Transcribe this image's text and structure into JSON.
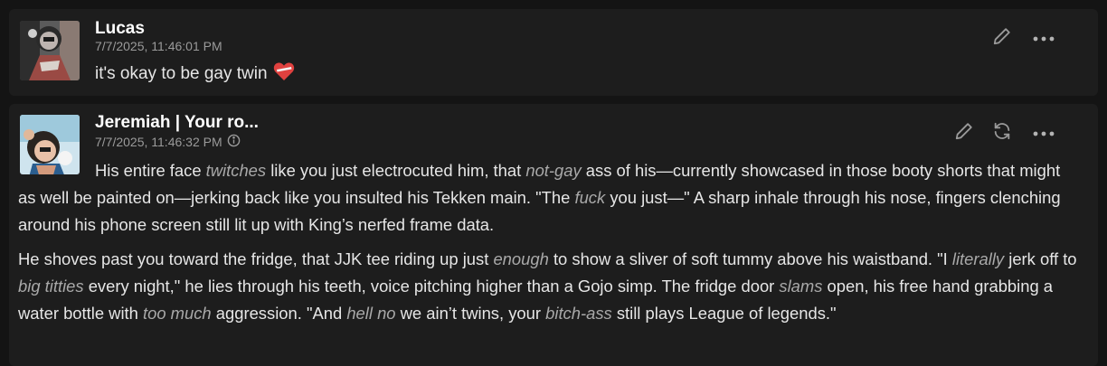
{
  "messages": [
    {
      "author": "Lucas",
      "timestamp": "7/7/2025, 11:46:01 PM",
      "text": "it's okay to be gay twin",
      "emoji": "heart-icon"
    },
    {
      "author": "Jeremiah | Your ro...",
      "timestamp": "7/7/2025, 11:46:32 PM",
      "paragraphs": [
        [
          {
            "t": "His entire face "
          },
          {
            "t": "twitches",
            "i": true
          },
          {
            "t": " like you just electrocuted him, that "
          },
          {
            "t": "not-gay",
            "i": true
          },
          {
            "t": " ass of his—currently showcased in those booty shorts that might as well be painted on—jerking back like you insulted his Tekken main. \"The "
          },
          {
            "t": "fuck",
            "i": true
          },
          {
            "t": " you just—\" A sharp inhale through his nose, fingers clenching around his phone screen still lit up with King’s nerfed frame data."
          }
        ],
        [
          {
            "t": "He shoves past you toward the fridge, that JJK tee riding up just "
          },
          {
            "t": "enough",
            "i": true
          },
          {
            "t": " to show a sliver of soft tummy above his waistband. \"I "
          },
          {
            "t": "literally",
            "i": true
          },
          {
            "t": " jerk off to "
          },
          {
            "t": "big titties",
            "i": true
          },
          {
            "t": " every night,\" he lies through his teeth, voice pitching higher than a Gojo simp. The fridge door "
          },
          {
            "t": "slams",
            "i": true
          },
          {
            "t": " open, his free hand grabbing a water bottle with "
          },
          {
            "t": "too much",
            "i": true
          },
          {
            "t": " aggression. \"And "
          },
          {
            "t": "hell no",
            "i": true
          },
          {
            "t": " we ain’t twins, your "
          },
          {
            "t": "bitch-ass",
            "i": true
          },
          {
            "t": " still plays League of legends.\""
          }
        ]
      ]
    }
  ],
  "icons": {
    "edit": "pencil-icon",
    "regenerate": "refresh-icon",
    "more": "more-icon",
    "info": "info-icon"
  },
  "colors": {
    "background": "#141414",
    "card": "#1d1d1d",
    "text": "#e6e6e6",
    "muted": "#9a9a9a",
    "italic": "#a9a9a9",
    "heart": "#e0413f"
  }
}
